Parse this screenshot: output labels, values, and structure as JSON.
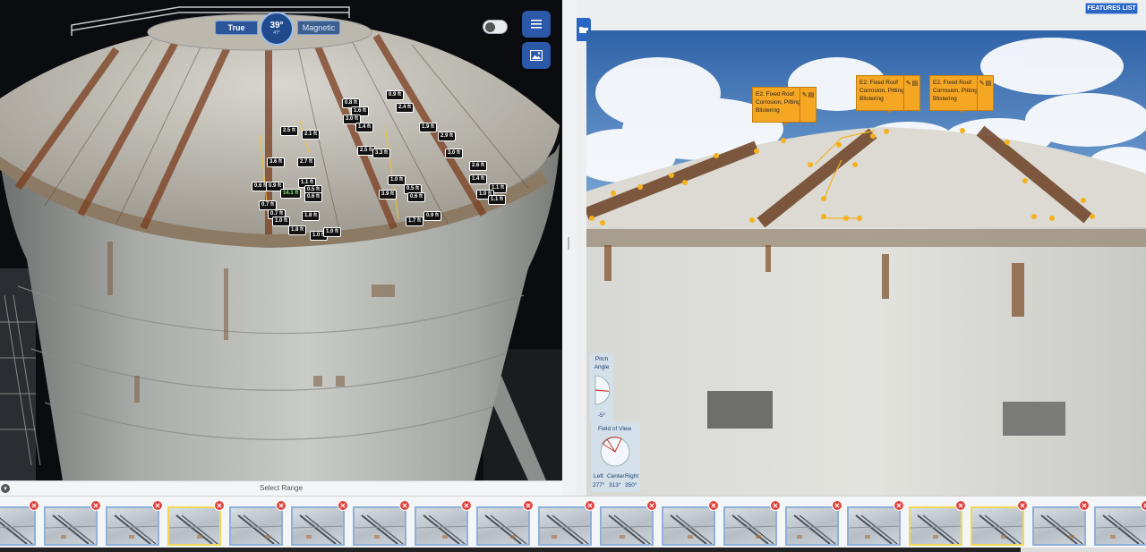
{
  "compass": {
    "true_label": "True",
    "heading": "39°",
    "sub": "47°",
    "magnetic_label": "Magnetic"
  },
  "measurements": [
    {
      "text": "0.9 ft"
    },
    {
      "text": "0.8 ft"
    },
    {
      "text": "2.4 ft"
    },
    {
      "text": "1.6 ft"
    },
    {
      "text": "3.0 ft"
    },
    {
      "text": "1.4 ft"
    },
    {
      "text": "1.9 ft"
    },
    {
      "text": "2.5 ft"
    },
    {
      "text": "2.1 ft"
    },
    {
      "text": "2.9 ft"
    },
    {
      "text": "2.5 ft"
    },
    {
      "text": "3.3 ft"
    },
    {
      "text": "3.0 ft"
    },
    {
      "text": "3.6 ft"
    },
    {
      "text": "2.7 ft"
    },
    {
      "text": "2.6 ft"
    },
    {
      "text": "1.4 ft"
    },
    {
      "text": "1.0 ft"
    },
    {
      "text": "1.1 ft"
    },
    {
      "text": "0.6 ft"
    },
    {
      "text": "0.9 ft"
    },
    {
      "text": "14.1 ft"
    },
    {
      "text": "0.5 ft"
    },
    {
      "text": "0.5 ft"
    },
    {
      "text": "1.1 ft"
    },
    {
      "text": "1.0 ft"
    },
    {
      "text": "0.6 ft"
    },
    {
      "text": "3.9 ft"
    },
    {
      "text": "0.6 ft"
    },
    {
      "text": "0.7 ft"
    },
    {
      "text": "1.8 ft"
    },
    {
      "text": "0.7 ft"
    },
    {
      "text": "0.9 ft"
    },
    {
      "text": "1.7 ft"
    },
    {
      "text": "1.8 ft"
    },
    {
      "text": "1.0 ft"
    },
    {
      "text": "1.0 ft"
    },
    {
      "text": "1.0 ft"
    },
    {
      "text": "1.1 ft"
    }
  ],
  "range_bar": {
    "label": "Select Range"
  },
  "features_button": "FEATURES LIST",
  "tags": [
    {
      "text": "E2. Fixed Roof Corrosion, Pitting Blistering"
    },
    {
      "text": "E2. Fixed Roof Corrosion, Pitting Blistering"
    },
    {
      "text": "E2. Fixed Roof Corrosion, Pitting Blistering"
    }
  ],
  "pitch": {
    "title1": "Pitch",
    "title2": "Angle",
    "value": "-5°"
  },
  "fov": {
    "title": "Field of View",
    "left_label": "Left",
    "center_label": "Center",
    "right_label": "Right",
    "left_value": "277°",
    "center_value": "313°",
    "right_value": "350°"
  },
  "thumbnails": [
    {
      "highlight": false
    },
    {
      "highlight": false
    },
    {
      "highlight": false
    },
    {
      "highlight": true
    },
    {
      "highlight": false
    },
    {
      "highlight": false
    },
    {
      "highlight": false
    },
    {
      "highlight": false
    },
    {
      "highlight": false
    },
    {
      "highlight": false
    },
    {
      "highlight": false
    },
    {
      "highlight": false
    },
    {
      "highlight": false
    },
    {
      "highlight": false
    },
    {
      "highlight": false
    },
    {
      "highlight": true
    },
    {
      "highlight": true
    },
    {
      "highlight": false
    },
    {
      "highlight": false
    }
  ],
  "icons": {
    "menu": "menu-icon",
    "image": "image-icon",
    "folder": "folder-icon",
    "close": "close-icon",
    "chevron": "chevron-down-icon",
    "edit": "pencil-icon",
    "delete": "trash-icon"
  },
  "colors": {
    "accent": "#2b58a8",
    "tag": "#f5a623",
    "close": "#e0403a"
  }
}
